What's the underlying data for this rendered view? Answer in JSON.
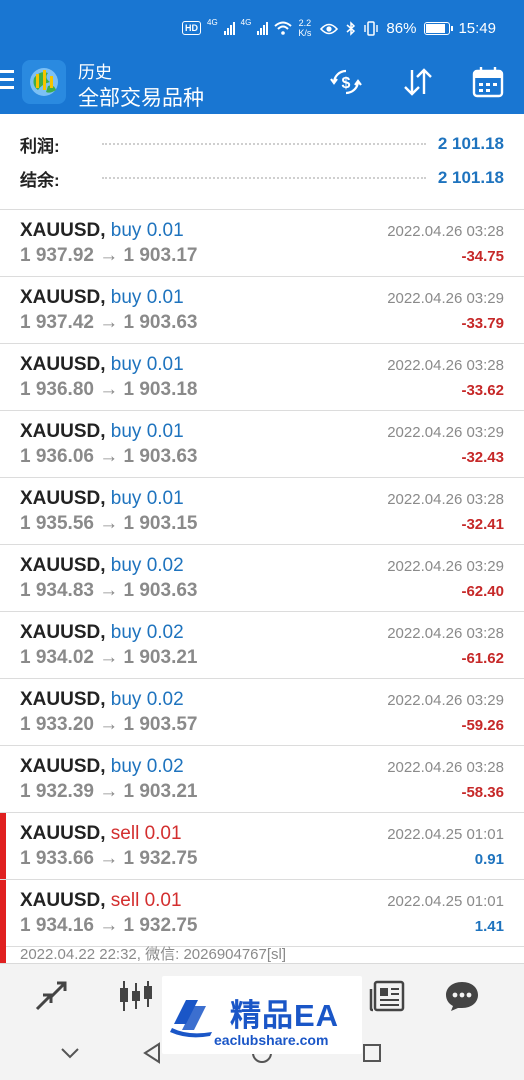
{
  "status_bar": {
    "hd_label": "HD",
    "sim1_tag": "4G",
    "sim2_tag": "4G",
    "net_speed": "2.2",
    "net_speed_unit": "K/s",
    "battery_percent": "86%",
    "battery_level": 0.86,
    "time": "15:49",
    "icons": [
      "eye-icon",
      "bluetooth-icon",
      "vibrate-icon",
      "battery-icon",
      "wifi-icon",
      "signal-icon"
    ]
  },
  "header": {
    "title_top": "历史",
    "title_main": "全部交易品种",
    "background": "#1976d2",
    "actions": [
      "currency-filter-icon",
      "sort-icon",
      "calendar-icon"
    ]
  },
  "summary": {
    "profit_label": "利润:",
    "profit_value": "2 101.18",
    "balance_label": "结余:",
    "balance_value": "2 101.18"
  },
  "trades": [
    {
      "symbol": "XAUUSD,",
      "type": "buy 0.01",
      "side": "buy",
      "prices": "1 937.92 → 1 903.17",
      "time": "2022.04.26 03:28",
      "profit": "-34.75"
    },
    {
      "symbol": "XAUUSD,",
      "type": "buy 0.01",
      "side": "buy",
      "prices": "1 937.42 → 1 903.63",
      "time": "2022.04.26 03:29",
      "profit": "-33.79"
    },
    {
      "symbol": "XAUUSD,",
      "type": "buy 0.01",
      "side": "buy",
      "prices": "1 936.80 → 1 903.18",
      "time": "2022.04.26 03:28",
      "profit": "-33.62"
    },
    {
      "symbol": "XAUUSD,",
      "type": "buy 0.01",
      "side": "buy",
      "prices": "1 936.06 → 1 903.63",
      "time": "2022.04.26 03:29",
      "profit": "-32.43"
    },
    {
      "symbol": "XAUUSD,",
      "type": "buy 0.01",
      "side": "buy",
      "prices": "1 935.56 → 1 903.15",
      "time": "2022.04.26 03:28",
      "profit": "-32.41"
    },
    {
      "symbol": "XAUUSD,",
      "type": "buy 0.02",
      "side": "buy",
      "prices": "1 934.83 → 1 903.63",
      "time": "2022.04.26 03:29",
      "profit": "-62.40"
    },
    {
      "symbol": "XAUUSD,",
      "type": "buy 0.02",
      "side": "buy",
      "prices": "1 934.02 → 1 903.21",
      "time": "2022.04.26 03:28",
      "profit": "-61.62"
    },
    {
      "symbol": "XAUUSD,",
      "type": "buy 0.02",
      "side": "buy",
      "prices": "1 933.20 → 1 903.57",
      "time": "2022.04.26 03:29",
      "profit": "-59.26"
    },
    {
      "symbol": "XAUUSD,",
      "type": "buy 0.02",
      "side": "buy",
      "prices": "1 932.39 → 1 903.21",
      "time": "2022.04.26 03:28",
      "profit": "-58.36"
    },
    {
      "symbol": "XAUUSD,",
      "type": "sell 0.01",
      "side": "sell",
      "prices": "1 933.66 → 1 932.75",
      "time": "2022.04.25 01:01",
      "profit": "0.91"
    },
    {
      "symbol": "XAUUSD,",
      "type": "sell 0.01",
      "side": "sell",
      "prices": "1 934.16 → 1 932.75",
      "time": "2022.04.25 01:01",
      "profit": "1.41"
    }
  ],
  "partial_row": "2022.04.22 22:32, 微信: 2026904767[sl]",
  "tabbar": {
    "tabs": [
      "trade-arrows-icon",
      "candlestick-chart-icon",
      "news-icon",
      "chat-icon"
    ]
  },
  "watermark": {
    "title": "精品EA",
    "url": "eaclubshare.com"
  },
  "navbar": {
    "buttons": [
      "hide-keyboard-icon",
      "back-icon",
      "home-icon",
      "recents-icon"
    ]
  }
}
